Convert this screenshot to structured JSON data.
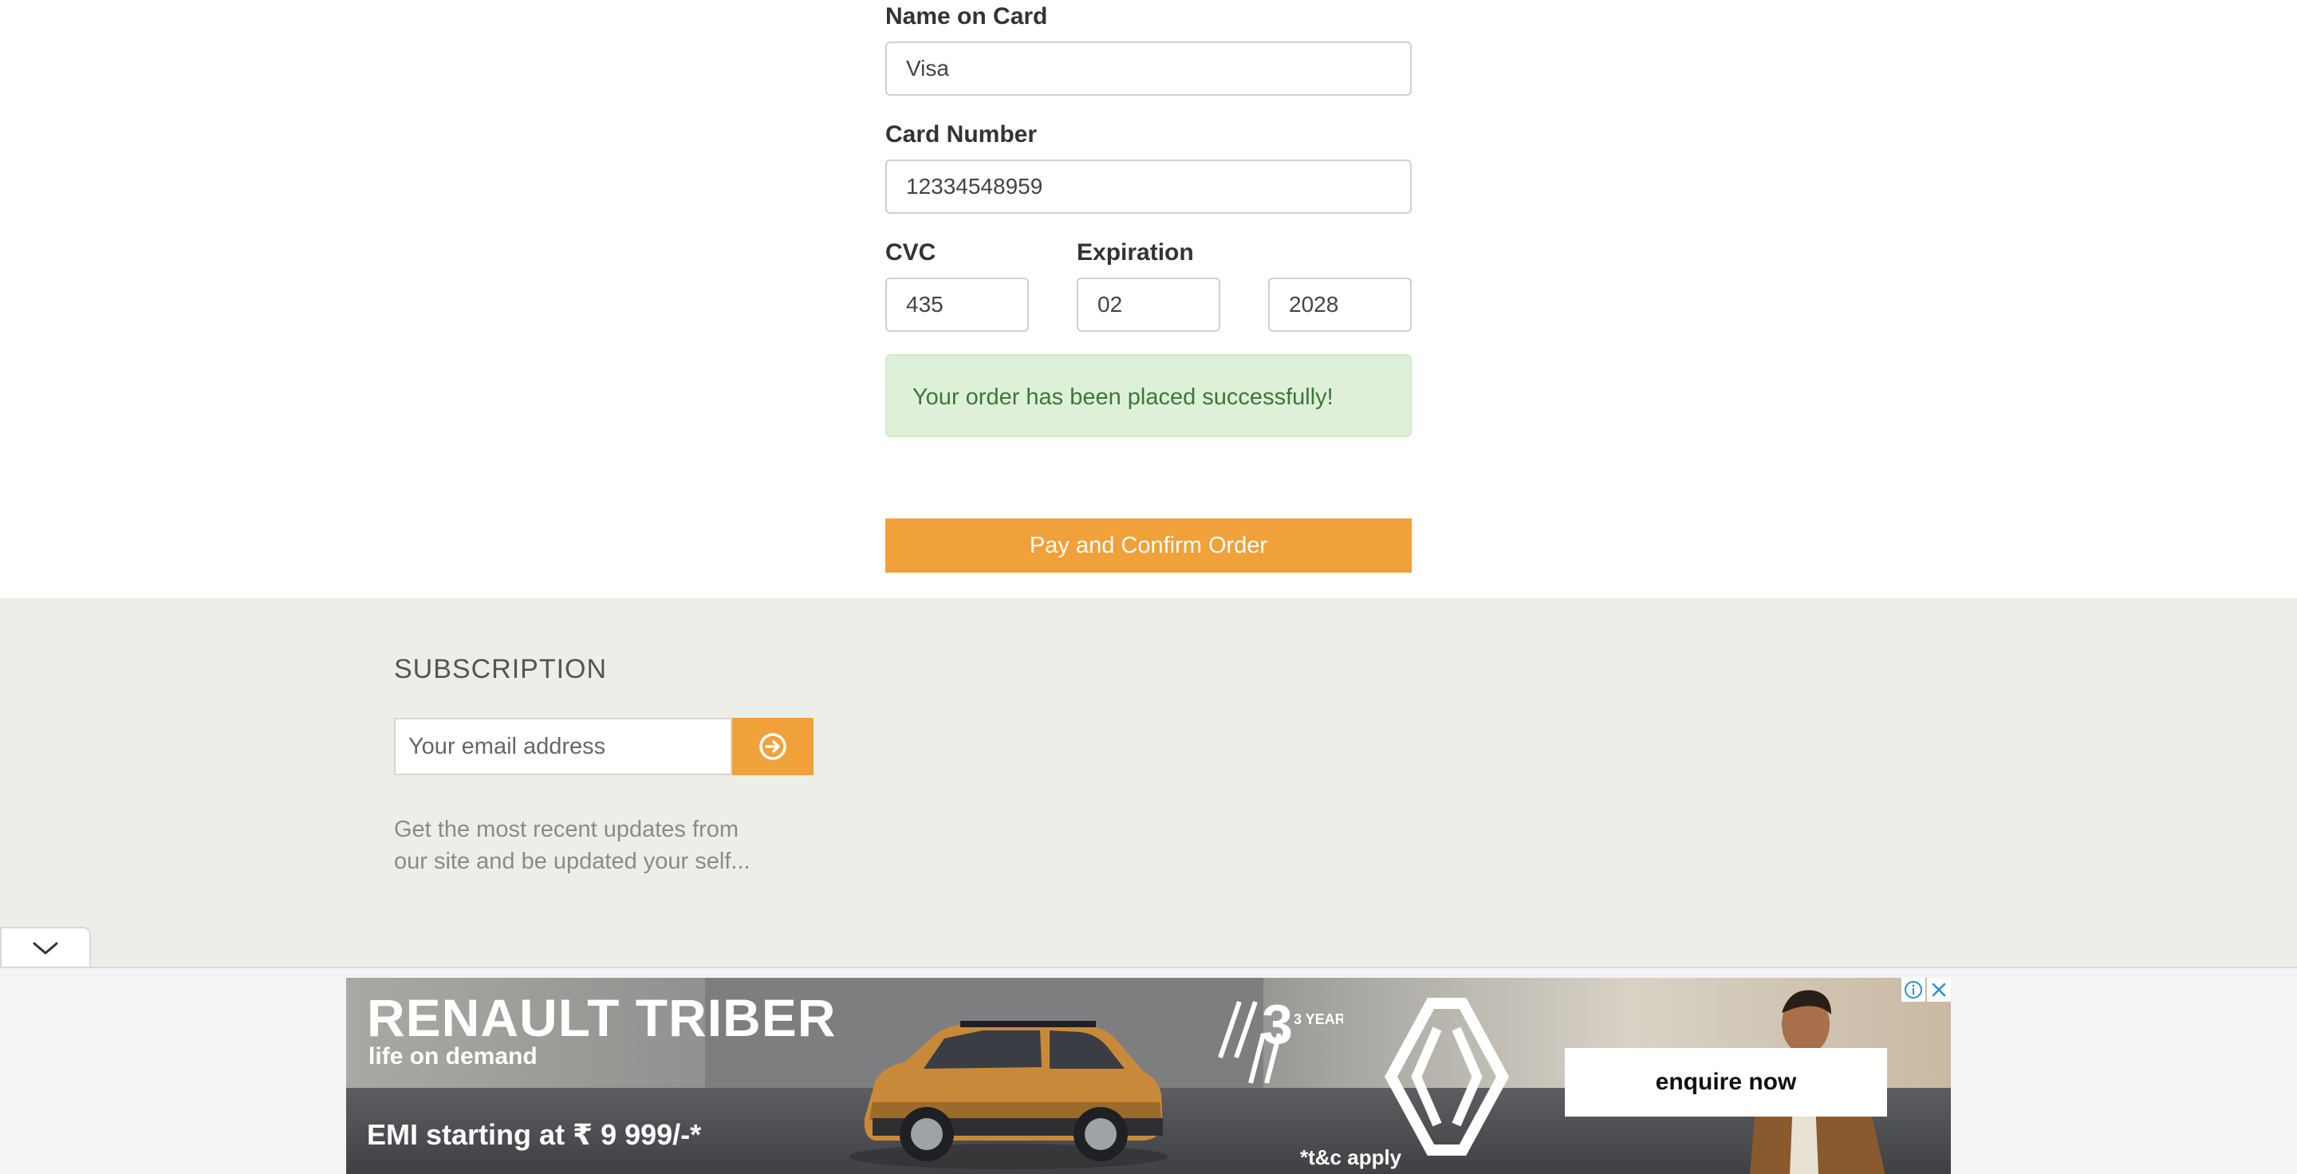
{
  "payment": {
    "name_label": "Name on Card",
    "name_value": "Visa",
    "card_number_label": "Card Number",
    "card_number_value": "12334548959",
    "cvc_label": "CVC",
    "cvc_value": "435",
    "expiration_label": "Expiration",
    "exp_month_value": "02",
    "exp_year_value": "2028",
    "success_message": "Your order has been placed successfully!",
    "confirm_button_label": "Pay and Confirm Order"
  },
  "footer": {
    "subscription_title": "SUBSCRIPTION",
    "email_placeholder": "Your email address",
    "subscribe_icon": "arrow-circle-right-icon",
    "description": "Get the most recent updates from our site and be updated your self..."
  },
  "ad": {
    "collapse_icon": "chevron-down-icon",
    "headline": "RENAULT TRIBER",
    "tagline": "life on demand",
    "emi_text": "EMI starting at ₹ 9 999/-*",
    "cta_label": "enquire now",
    "terms_text": "*t&c apply",
    "warranty_badge": "3 YEAR",
    "info_icon": "info-icon",
    "close_icon": "close-icon"
  },
  "colors": {
    "accent": "#f0a13a",
    "success_bg": "#dff0d8",
    "success_text": "#3c763d",
    "footer_bg": "#eeeee8"
  }
}
